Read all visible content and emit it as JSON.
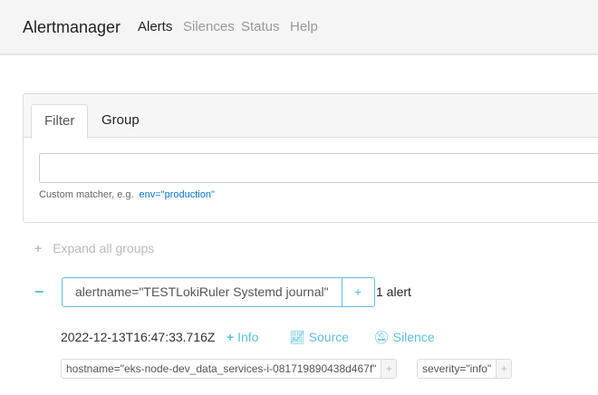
{
  "nav": {
    "brand": "Alertmanager",
    "links": [
      "Alerts",
      "Silences",
      "Status",
      "Help"
    ]
  },
  "filter": {
    "tabs": [
      "Filter",
      "Group"
    ],
    "value": "",
    "hint": "Custom matcher, e.g.",
    "example": "env=\"production\""
  },
  "expand": {
    "icon": "+",
    "label": "Expand all groups"
  },
  "group": {
    "collapse_icon": "−",
    "label": "alertname=\"TESTLokiRuler Systemd journal\"",
    "add": "+",
    "count": "1 alert"
  },
  "alert": {
    "timestamp": "2022-12-13T16:47:33.716Z",
    "info": "Info",
    "source": "Source",
    "silence": "Silence",
    "labels": [
      {
        "text": "hostname=\"eks-node-dev_data_services-i-081719890438d467f\"",
        "add": "+"
      },
      {
        "text": "severity=\"info\"",
        "add": "+"
      }
    ]
  }
}
